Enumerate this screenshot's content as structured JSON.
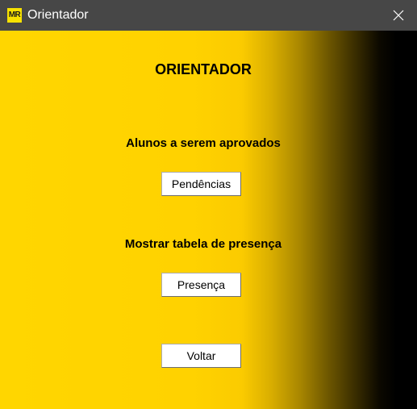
{
  "window": {
    "title": "Orientador",
    "icon_text": "MR",
    "icon": "app-logo-icon",
    "close_icon": "close-icon"
  },
  "main": {
    "title": "ORIENTADOR",
    "sections": [
      {
        "label": "Alunos a serem aprovados",
        "button_label": "Pendências"
      },
      {
        "label": "Mostrar tabela de presença",
        "button_label": "Presença"
      }
    ],
    "back_button_label": "Voltar"
  },
  "colors": {
    "background_gradient_start": "#ffd600",
    "background_gradient_end": "#000000",
    "titlebar": "#474747",
    "button_background": "#ffffff",
    "text": "#000000"
  }
}
